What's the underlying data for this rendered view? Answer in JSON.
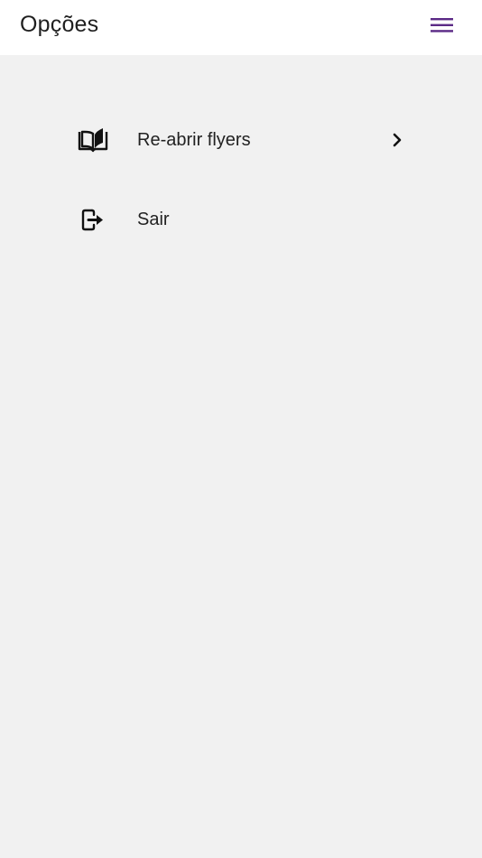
{
  "header": {
    "title": "Opções",
    "menu_icon": "hamburger-menu-icon",
    "accent_color": "#5b2a86"
  },
  "menu": {
    "items": [
      {
        "label": "Re-abrir flyers",
        "icon": "open-book-icon",
        "has_chevron": true
      },
      {
        "label": "Sair",
        "icon": "logout-icon",
        "has_chevron": false
      }
    ]
  },
  "colors": {
    "background": "#f1f1f1",
    "app_bar": "#ffffff",
    "text": "#222222"
  }
}
